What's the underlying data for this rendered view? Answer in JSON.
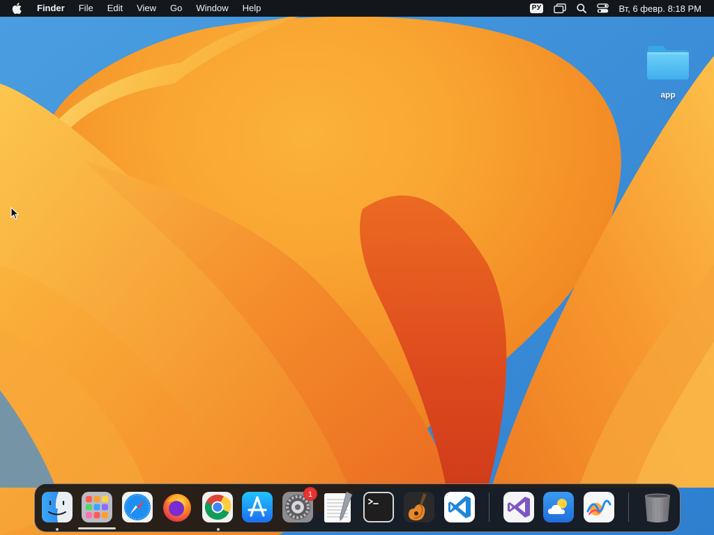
{
  "menubar": {
    "apple_icon": "apple-logo-icon",
    "app_name": "Finder",
    "menus": [
      "File",
      "Edit",
      "View",
      "Go",
      "Window",
      "Help"
    ],
    "input_language": "РУ",
    "clock": "Вт, 6 февр.  8:18 PM",
    "status_icons": [
      "window-switcher-icon",
      "search-icon",
      "control-center-icon"
    ]
  },
  "desktop": {
    "folder_label": "app",
    "folder_icon": "folder-icon",
    "folder_color": "#5ec2f2",
    "cursor_icon": "arrow-cursor-icon"
  },
  "dock": {
    "badge_settings": "1",
    "apps": [
      {
        "name": "Finder",
        "icon": "finder-icon",
        "running": true
      },
      {
        "name": "Launchpad",
        "icon": "launchpad-icon",
        "running": false
      },
      {
        "name": "Safari",
        "icon": "safari-icon",
        "running": false
      },
      {
        "name": "Firefox",
        "icon": "firefox-icon",
        "running": false
      },
      {
        "name": "Google Chrome",
        "icon": "chrome-icon",
        "running": true
      },
      {
        "name": "App Store",
        "icon": "app-store-icon",
        "running": false
      },
      {
        "name": "System Settings",
        "icon": "settings-gear-icon",
        "running": false
      },
      {
        "name": "TextEdit",
        "icon": "textedit-icon",
        "running": false
      },
      {
        "name": "Terminal",
        "icon": "terminal-icon",
        "running": false
      },
      {
        "name": "GarageBand",
        "icon": "garageband-guitar-icon",
        "running": false
      },
      {
        "name": "Visual Studio Code",
        "icon": "vscode-icon",
        "running": false
      },
      {
        "name": "Visual Studio",
        "icon": "visual-studio-icon",
        "running": false
      },
      {
        "name": "Weather",
        "icon": "weather-icon",
        "running": false
      },
      {
        "name": "Freeform",
        "icon": "freeform-icon",
        "running": false
      },
      {
        "name": "Trash",
        "icon": "trash-icon",
        "running": false
      }
    ]
  },
  "colors": {
    "wallpaper_blue": "#3c8fd6",
    "wallpaper_orange": "#f5922a",
    "wallpaper_yellow": "#fbd36a",
    "wallpaper_red": "#d8461f",
    "menubar_bg": "#121214",
    "badge_red": "#e8332f"
  }
}
